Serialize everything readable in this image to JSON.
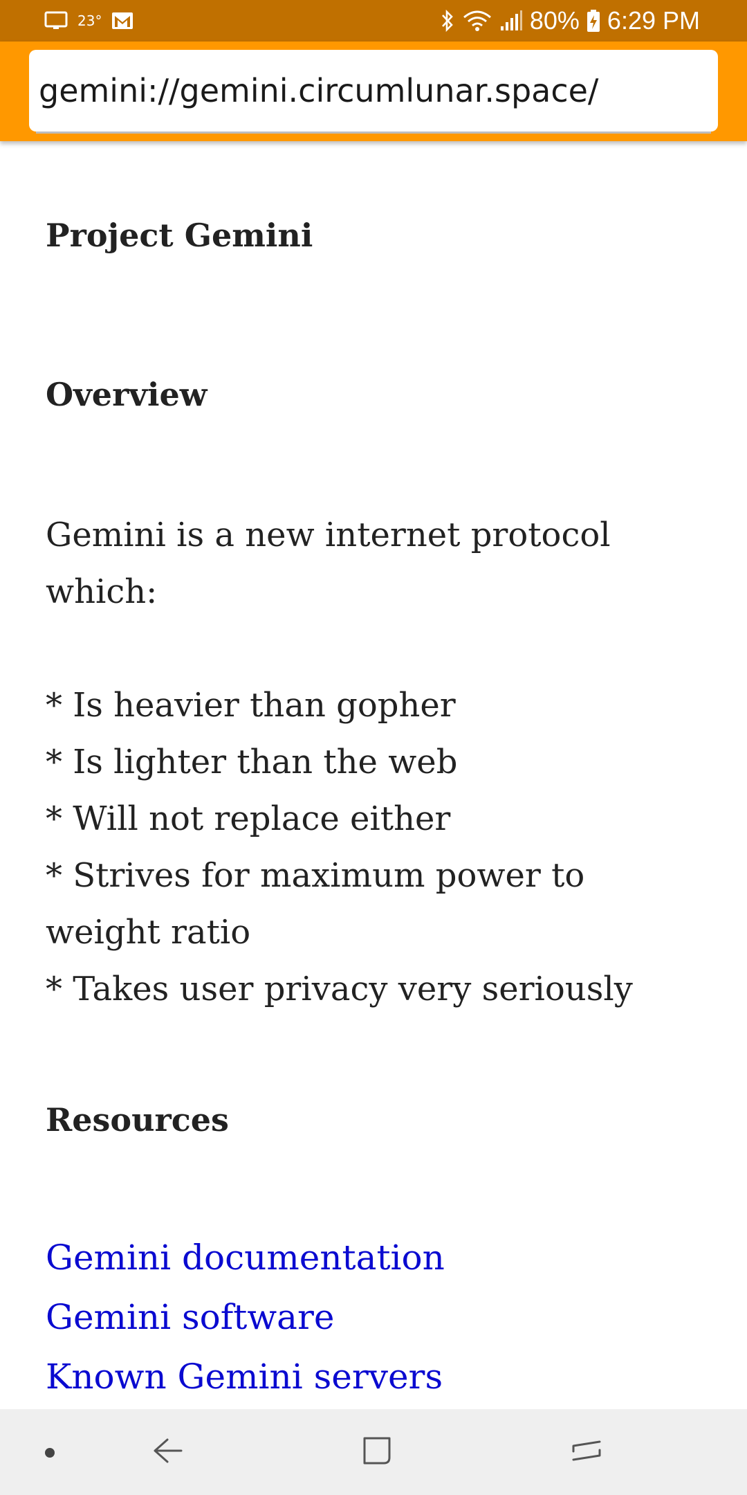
{
  "status_bar": {
    "temperature": "23°",
    "battery": "80%",
    "time": "6:29 PM",
    "icons": [
      "screen-icon",
      "gmail-icon",
      "bluetooth-icon",
      "wifi-icon",
      "signal-icon",
      "battery-charging-icon"
    ]
  },
  "browser": {
    "url": "gemini://gemini.circumlunar.space/"
  },
  "page": {
    "title": "Project Gemini",
    "overview_heading": "Overview",
    "intro_text": "Gemini is a new internet protocol which:",
    "bullets": [
      "* Is heavier than gopher",
      "* Is lighter than the web",
      "* Will not replace either",
      "* Strives for maximum power to weight ratio",
      "* Takes user privacy very seriously"
    ],
    "resources_heading": "Resources",
    "links": [
      "Gemini documentation",
      "Gemini software",
      "Known Gemini servers"
    ]
  },
  "nav_bar": {
    "icons": [
      "nav-dot-icon",
      "back-icon",
      "home-icon",
      "recents-icon"
    ]
  },
  "colors": {
    "status_bar_bg": "#c07000",
    "toolbar_bg": "#ff9800",
    "link": "#0a0ad0",
    "text": "#222222",
    "nav_bg": "#efefef"
  }
}
